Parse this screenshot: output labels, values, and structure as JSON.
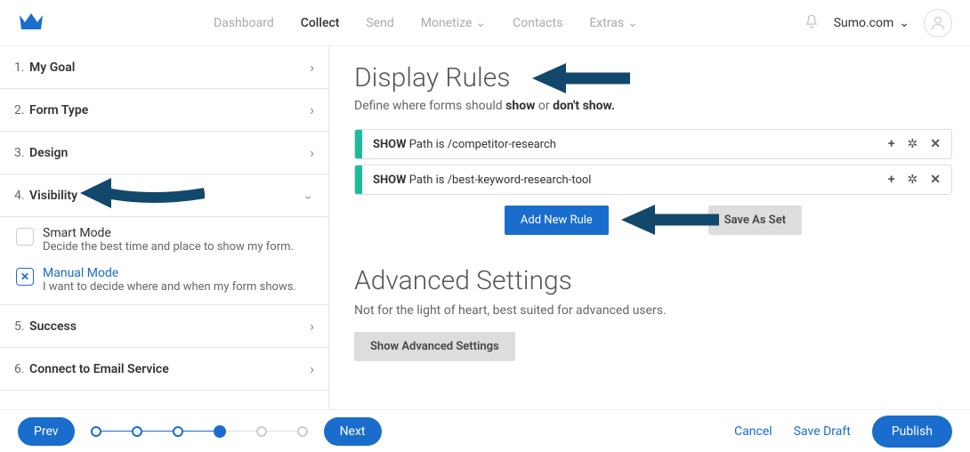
{
  "header": {
    "nav": [
      "Dashboard",
      "Collect",
      "Send",
      "Monetize",
      "Contacts",
      "Extras"
    ],
    "nav_active_index": 1,
    "nav_dropdowns": [
      false,
      false,
      false,
      true,
      false,
      true
    ],
    "account_label": "Sumo.com"
  },
  "sidebar": {
    "steps": [
      {
        "num": "1.",
        "name": "My Goal"
      },
      {
        "num": "2.",
        "name": "Form Type"
      },
      {
        "num": "3.",
        "name": "Design"
      },
      {
        "num": "4.",
        "name": "Visibility"
      },
      {
        "num": "5.",
        "name": "Success"
      },
      {
        "num": "6.",
        "name": "Connect to Email Service"
      }
    ],
    "active_index": 3,
    "modes": {
      "smart": {
        "title": "Smart Mode",
        "desc": "Decide the best time and place to show my form.",
        "checked": false
      },
      "manual": {
        "title": "Manual Mode",
        "desc": "I want to decide where and when my form shows.",
        "checked": true
      }
    }
  },
  "content": {
    "title": "Display Rules",
    "subtitle_pre": "Define where forms should ",
    "subtitle_show": "show",
    "subtitle_mid": " or ",
    "subtitle_dont": "don't show.",
    "rules": [
      {
        "prefix": "SHOW",
        "text": " Path is /competitor-research"
      },
      {
        "prefix": "SHOW",
        "text": " Path is /best-keyword-research-tool"
      }
    ],
    "add_rule_label": "Add New Rule",
    "save_set_label": "Save As Set",
    "advanced_title": "Advanced Settings",
    "advanced_sub": "Not for the light of heart, best suited for advanced users.",
    "show_advanced_label": "Show Advanced Settings"
  },
  "footer": {
    "prev": "Prev",
    "next": "Next",
    "cancel": "Cancel",
    "save_draft": "Save Draft",
    "publish": "Publish"
  }
}
